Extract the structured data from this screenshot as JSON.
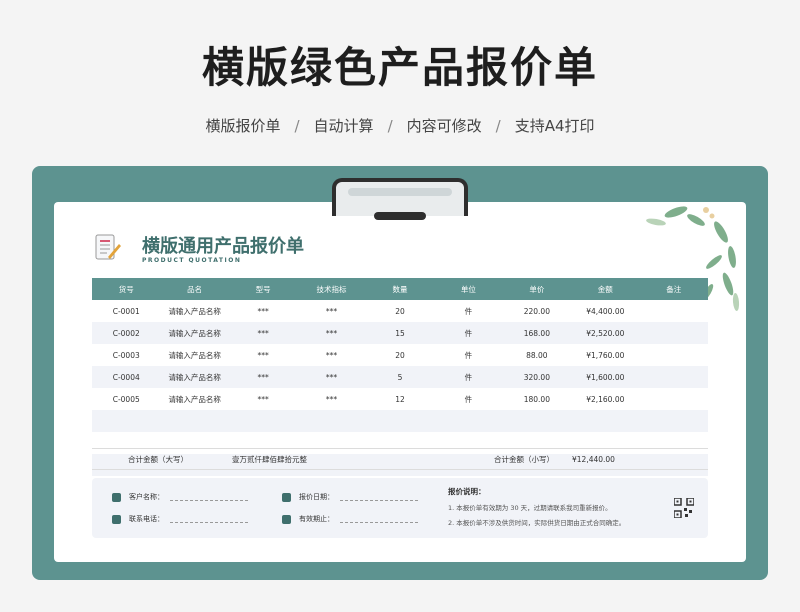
{
  "header": {
    "main_title": "横版绿色产品报价单",
    "features": [
      "横版报价单",
      "自动计算",
      "内容可修改",
      "支持A4打印"
    ],
    "separator": "/"
  },
  "document": {
    "title": "横版通用产品报价单",
    "subtitle": "PRODUCT QUOTATION",
    "columns": [
      "货号",
      "品名",
      "型号",
      "技术指标",
      "数量",
      "单位",
      "单价",
      "金额",
      "备注"
    ],
    "rows": [
      [
        "C-0001",
        "请输入产品名称",
        "***",
        "***",
        "20",
        "件",
        "220.00",
        "¥4,400.00",
        ""
      ],
      [
        "C-0002",
        "请输入产品名称",
        "***",
        "***",
        "15",
        "件",
        "168.00",
        "¥2,520.00",
        ""
      ],
      [
        "C-0003",
        "请输入产品名称",
        "***",
        "***",
        "20",
        "件",
        "88.00",
        "¥1,760.00",
        ""
      ],
      [
        "C-0004",
        "请输入产品名称",
        "***",
        "***",
        "5",
        "件",
        "320.00",
        "¥1,600.00",
        ""
      ],
      [
        "C-0005",
        "请输入产品名称",
        "***",
        "***",
        "12",
        "件",
        "180.00",
        "¥2,160.00",
        ""
      ]
    ],
    "empty_rows": 3,
    "totals": {
      "upper_label": "合计金额（大写）",
      "upper_value": "壹万贰仟肆佰肆拾元整",
      "lower_label": "合计金额（小写）",
      "lower_value": "¥12,440.00"
    },
    "info": {
      "customer_name": "客户名称：",
      "quote_date": "报价日期：",
      "contact_phone": "联系电话：",
      "valid_until": "有效期止：",
      "notes_title": "报价说明：",
      "notes": [
        "1. 本报价单有效期为 30 天，过期请联系我司重新报价。",
        "2. 本报价单不涉及供货时间，实际供货日期由正式合同确定。"
      ]
    }
  },
  "colors": {
    "accent": "#5d9390",
    "accent_dark": "#3f6f6d",
    "stripe": "#f1f3f8"
  }
}
